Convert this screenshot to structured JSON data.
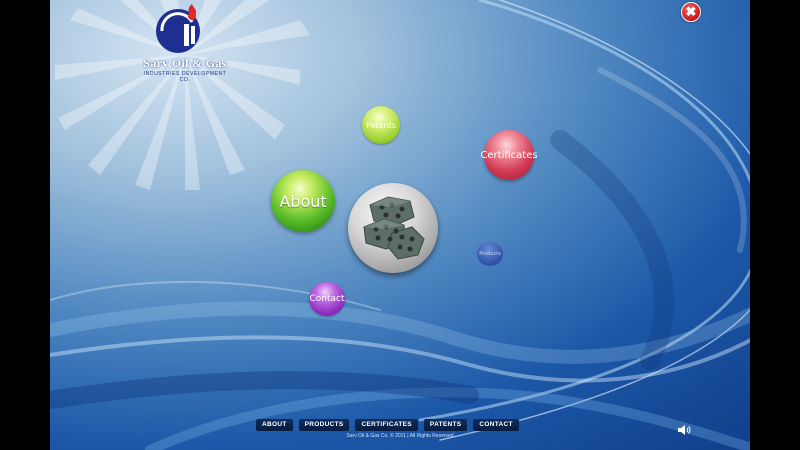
{
  "logo": {
    "name": "Sarv Oil & Gas",
    "tagline": "INDUSTRIES DEVELOPMENT CO."
  },
  "close_icon": "close-icon",
  "bubbles": {
    "about": "About",
    "certificates": "Certificates",
    "patents": "Patents",
    "contact": "Contact",
    "products": "Products"
  },
  "footer": {
    "nav": [
      "ABOUT",
      "PRODUCTS",
      "CERTIFICATES",
      "PATENTS",
      "CONTACT"
    ],
    "copyright": "Sarv Oil & Gas Co. © 2011 | All Rights Reserved"
  },
  "sound_icon": "speaker-icon",
  "colors": {
    "background": "#1c58a8",
    "close": "#c41818",
    "about": "#5fc02d",
    "certificates": "#d23a52",
    "patents": "#99cf2e",
    "contact": "#8a2bc0",
    "products": "#3250aa"
  }
}
